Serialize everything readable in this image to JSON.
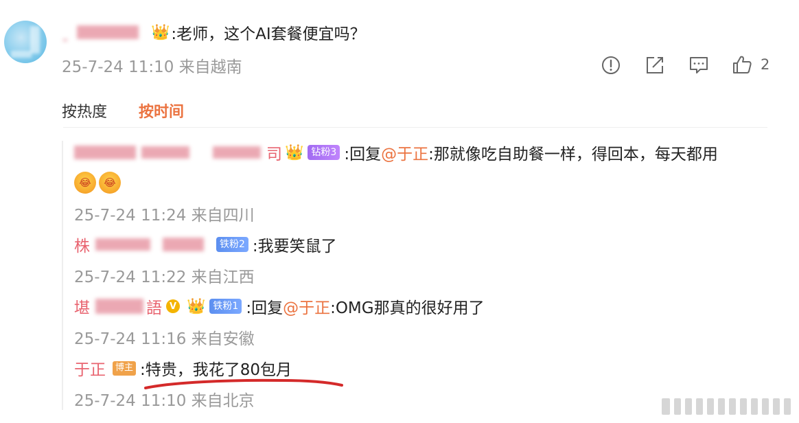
{
  "comment": {
    "text": ":老师，这个AI套餐便宜吗？",
    "time": "25-7-24 11:10 来自越南",
    "like_count": "2"
  },
  "sort_tabs": {
    "hot": "按热度",
    "time": "按时间"
  },
  "replies": [
    {
      "badge": "钻粉3",
      "reply_prefix": ":回复",
      "mention": "@于正",
      "text": ":那就像吃自助餐一样，得回本，每天都用",
      "time": "25-7-24 11:24 来自四川"
    },
    {
      "name_visible": "株",
      "badge": "铁粉2",
      "text": ":我要笑鼠了",
      "time": "25-7-24 11:22 来自江西"
    },
    {
      "name_visible": "堪",
      "name_visible_end": "語",
      "badge": "铁粉1",
      "reply_prefix": ":回复",
      "mention": "@于正",
      "text": ":OMG那真的很好用了",
      "time": "25-7-24 11:16 来自安徽"
    },
    {
      "name": "于正",
      "badge": "博主",
      "text": ":特贵，我花了80包月",
      "time": "25-7-24 11:10 来自北京"
    }
  ],
  "icons": {
    "report": "exclamation-circle-icon",
    "share": "share-icon",
    "comment": "comment-icon",
    "like": "thumbs-up-icon",
    "vip_crown": "crown-icon",
    "verified": "verified-v-icon",
    "laugh_emoji": "laughing-emoji-icon"
  },
  "colors": {
    "username_pink": "#e8636f",
    "mention_orange": "#eb7340",
    "meta_gray": "#999999",
    "underline_red": "#d42a2a"
  }
}
